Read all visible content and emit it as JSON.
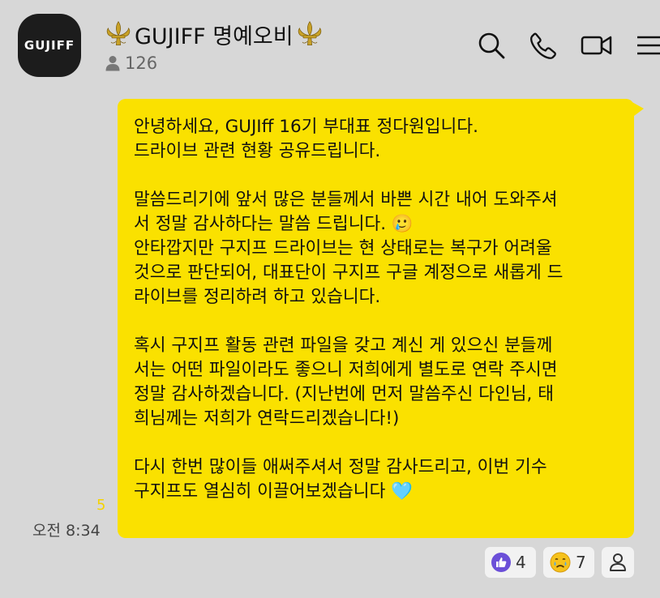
{
  "chat": {
    "avatar_text": "GUJIFF",
    "title": "GUJIFF 명예오비",
    "member_count": "126"
  },
  "message": {
    "lines": [
      "안녕하세요, GUJIff 16기 부대표 정다원입니다.",
      "드라이브 관련 현황 공유드립니다.",
      "",
      "말씀드리기에 앞서 많은 분들께서 바쁜 시간 내어 도와주셔",
      "서 정말 감사하다는 말씀 드립니다. 🥲",
      "안타깝지만 구지프 드라이브는 현 상태로는 복구가 어려울",
      "것으로 판단되어, 대표단이 구지프 구글 계정으로 새롭게 드",
      "라이브를 정리하려 하고 있습니다.",
      "",
      "혹시 구지프 활동 관련 파일을 갖고 계신 게 있으신 분들께",
      "서는 어떤 파일이라도 좋으니 저희에게 별도로 연락 주시면",
      "정말 감사하겠습니다. (지난번에 먼저 말씀주신 다인님, 태",
      "희님께는 저희가 연락드리겠습니다!)",
      "",
      "다시 한번 많이들 애써주셔서 정말 감사드리고, 이번 기수",
      "구지프도 열심히 이끌어보겠습니다 🩵"
    ],
    "read_count": "5",
    "time": "오전 8:34"
  },
  "reactions": {
    "like_count": "4",
    "sad_count": "7"
  },
  "colors": {
    "bubble": "#fae100",
    "background": "#d7d7d7",
    "read_count": "#f5d300",
    "like_badge": "#6b4fd8"
  },
  "icons": [
    "fleur-de-lis-icon",
    "person-icon",
    "search-icon",
    "phone-icon",
    "video-icon",
    "menu-icon",
    "thumbs-up-icon",
    "sad-face-icon",
    "heart-icon"
  ]
}
